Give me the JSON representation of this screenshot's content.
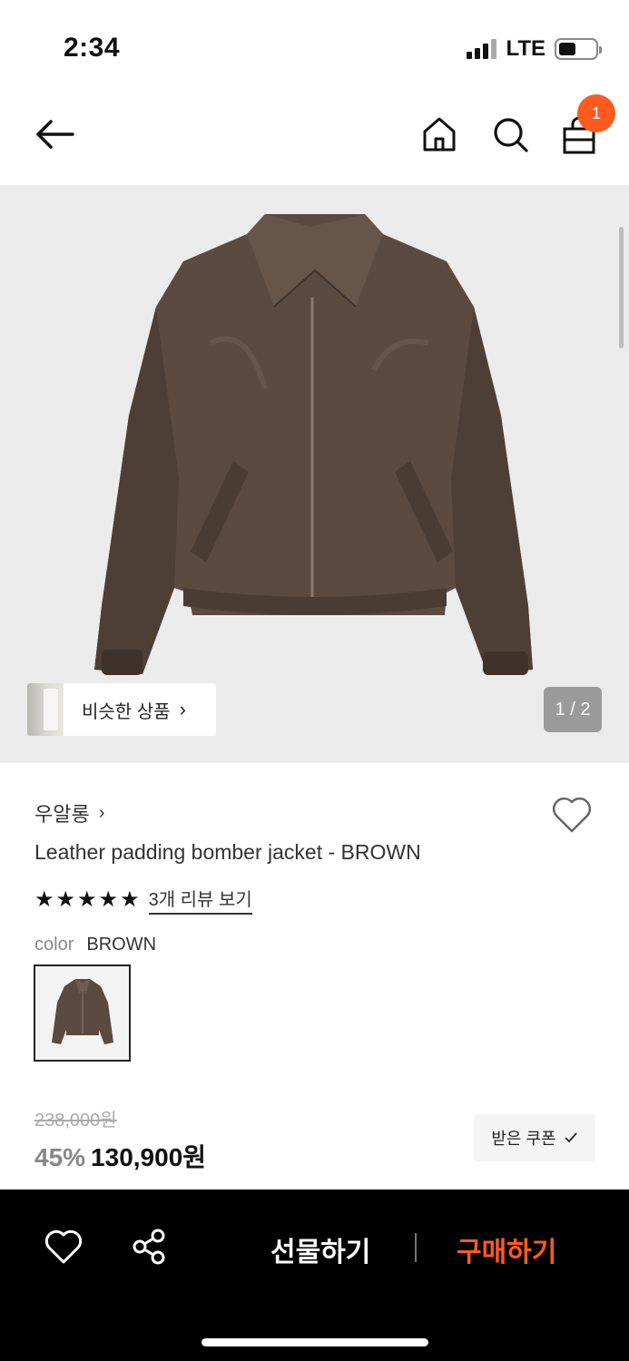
{
  "status_bar": {
    "time": "2:34",
    "network": "LTE"
  },
  "header": {
    "cart_count": "1",
    "icons": [
      "back-arrow-icon",
      "home-icon",
      "search-icon",
      "shopping-bag-icon"
    ]
  },
  "gallery": {
    "similar_label": "비슷한 상품",
    "page_indicator": "1 / 2",
    "background": "#ebebeb"
  },
  "product": {
    "brand": "우알롱",
    "title": "Leather padding bomber jacket - BROWN",
    "rating_stars": 5,
    "review_link": "3개 리뷰 보기",
    "option_label": "color",
    "option_value": "BROWN"
  },
  "price": {
    "original": "238,000원",
    "discount": "45%",
    "sale": "130,900원",
    "coupon_label": "받은 쿠폰"
  },
  "bottom_bar": {
    "gift_label": "선물하기",
    "buy_label": "구매하기"
  },
  "colors": {
    "accent": "#ff5a1f",
    "jacket_brown": "#5b4a40",
    "bottom_bar": "#000000"
  }
}
